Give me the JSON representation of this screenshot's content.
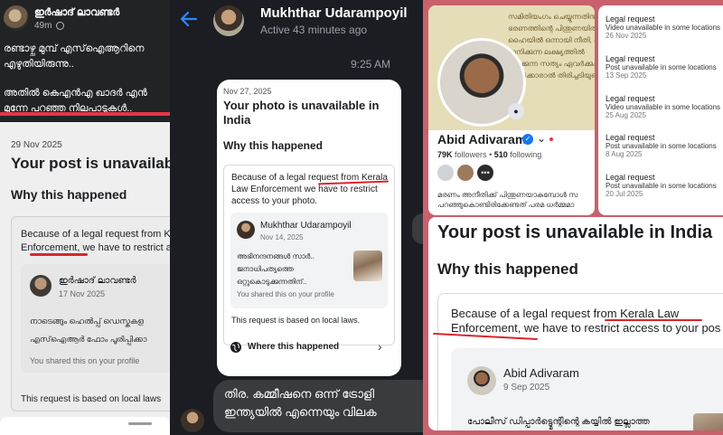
{
  "panel_left": {
    "author_name": "ഇർഷാദ് ലാവണ്ടർ",
    "time": "49m",
    "post_lines": [
      "രണ്ടാഴ്ച മുമ്പ് എസ്ഐആറിനെ",
      "എഴുതിയിരുന്നു..",
      "അതിൽ കെഎൻഎ ഖാദർ എൻ",
      "മുന്നേ പറഞ്ഞ നിലപാടുകൾ.."
    ],
    "notice": {
      "date": "29 Nov 2025",
      "title": "Your post is unavailable",
      "why_heading": "Why this happened",
      "reason_line1": "Because of a legal request from K",
      "reason_line2": "Enforcement, we have to restrict a",
      "shared_post": {
        "author": "ഇർഷാദ് ലാവണ്ടർ",
        "date": "17 Nov 2025",
        "line1": "നാടെങ്ങും ഹെൽപ്പ് ഡെസ്കുകള",
        "line2": "എസ്ഐആർ ഫോം പൂരിപ്പിക്കാ",
        "shared_note": "You shared this on your profile"
      },
      "local_laws": "This request is based on local laws"
    }
  },
  "panel_middle": {
    "contact_name": "Mukhthar Udarampoyil",
    "active_status": "Active 43 minutes ago",
    "message_time": "9:25 AM",
    "notice": {
      "date": "Nov 27, 2025",
      "title": "Your photo is unavailable in India",
      "why_heading": "Why this happened",
      "reason": "Because of a legal request from Kerala Law Enforcement we have to restrict access to your photo.",
      "shared_post": {
        "author": "Mukhthar Udarampoyil",
        "date": "Nov 14, 2025",
        "text": "അഭിനന്ദനങ്ങൾ സാർ.. ജനാധിപത്യത്തെ ഒറ്റുകൊടുക്കുന്നതിന്..",
        "shared_note": "You shared this on your profile"
      },
      "local_laws": "This request is based on local laws.",
      "where_link": "Where this happened"
    },
    "reply_lines": [
      "തിര. കമ്മീഷനെ ഒന്ന് ട്രോളി",
      "ഇന്ത്യയിൽ എന്നെയും വിലക"
    ]
  },
  "panel_right": {
    "cover_lines": [
      "സമിതിയംഗം ചെയ്യുന്നതിനും കാര",
      "ഭരണത്തിന്റെ പിന്തുണയിൽ പരാജയ",
      "ഹൈയിൽ ഒന്നായി നീതി, ലിംഗ",
      "മാനിക്കുന്ന ലക്ഷ്യത്തിൽ",
      "ലഭിക്കുന്ന സത്യം ഏവർക്കും",
      "ആൾക്കാരാൽ തിരിച്ചടിയുണ്ടായി"
    ],
    "profile": {
      "name": "Abid Adivaram",
      "followers_count": "79K",
      "followers_label": "followers",
      "following_count": "510",
      "following_label": "following",
      "bio_line1": "മരണം അനീതിക്ക് പിന്തുണയാകുമ്പോൾ സ",
      "bio_line2": "പറഞ്ഞുകൊണ്ടിരിക്കേണ്ടത് പരമ ധർമ്മമാ"
    },
    "notifications": [
      {
        "title": "Legal request",
        "subtitle": "Video unavailable in some locations",
        "date": "26 Nov 2025"
      },
      {
        "title": "Legal request",
        "subtitle": "Post unavailable in some locations",
        "date": "13 Sep 2025"
      },
      {
        "title": "Legal request",
        "subtitle": "Video unavailable in some locations",
        "date": "25 Aug 2025"
      },
      {
        "title": "Legal request",
        "subtitle": "Post unavailable in some locations",
        "date": "8 Aug 2025"
      },
      {
        "title": "Legal request",
        "subtitle": "Post unavailable in some locations",
        "date": "20 Jul 2025"
      }
    ],
    "notice": {
      "title": "Your post is unavailable in India",
      "why_heading": "Why this happened",
      "reason_line1": "Because of a legal request from Kerala Law",
      "reason_line2": "Enforcement, we have to restrict access to your pos",
      "shared_post": {
        "author": "Abid Adivaram",
        "date": "9 Sep 2025",
        "text": "പോലീസ് ഡിപ്പാർട്ട്മെന്റിന്റെ കയ്യിൽ ഇല്ലാത്ത"
      }
    }
  },
  "colors": {
    "annotation_red": "#d8262d",
    "verified_blue": "#1877f2",
    "dark_bg": "#1b1d22",
    "collage_border": "#c9606c"
  }
}
